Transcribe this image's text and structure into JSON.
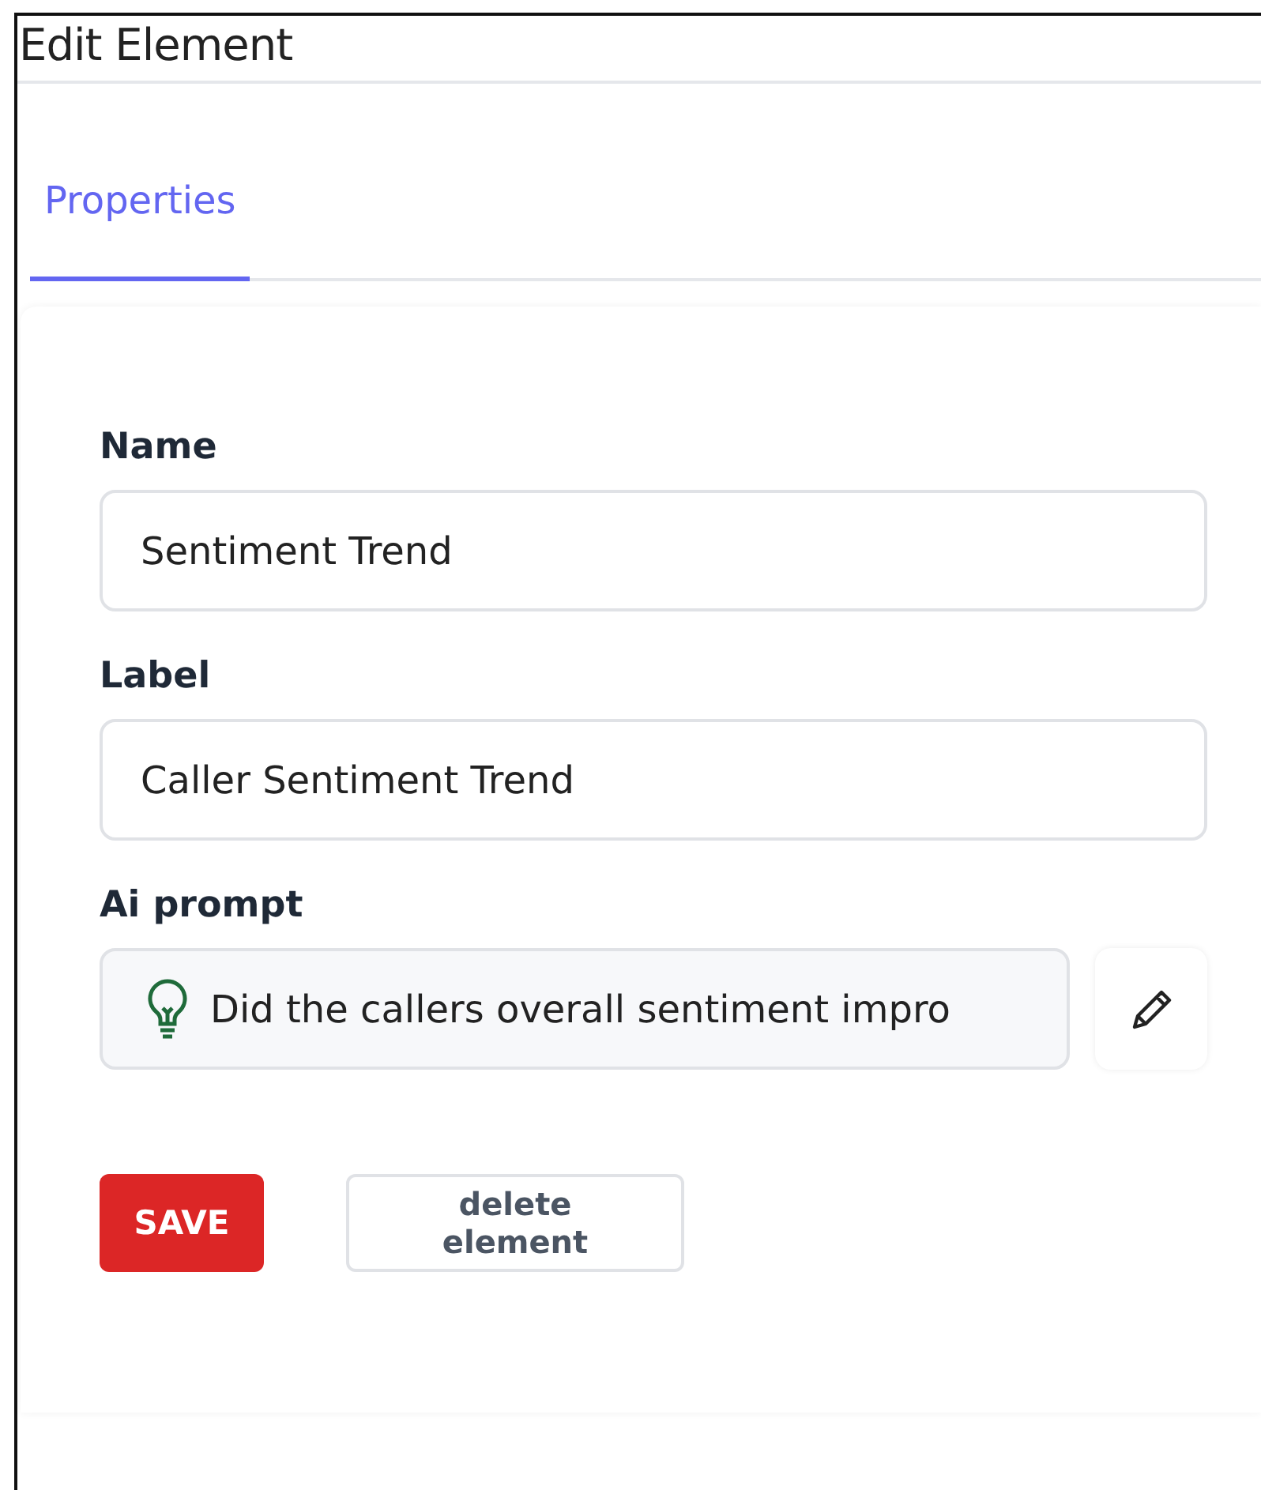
{
  "window": {
    "title": "Edit Element"
  },
  "tabs": [
    {
      "label": "Properties",
      "selected": true
    }
  ],
  "fields": [
    {
      "kind": "text",
      "label": "Name",
      "value": "Sentiment Trend"
    },
    {
      "kind": "text",
      "label": "Label",
      "value": "Caller Sentiment Trend"
    },
    {
      "kind": "prompt",
      "label": "Ai prompt",
      "value": "Did the callers overall sentiment impro"
    }
  ],
  "buttons": [
    {
      "kind": "primary",
      "label": "SAVE"
    },
    {
      "kind": "secondary",
      "label": "delete element"
    }
  ]
}
